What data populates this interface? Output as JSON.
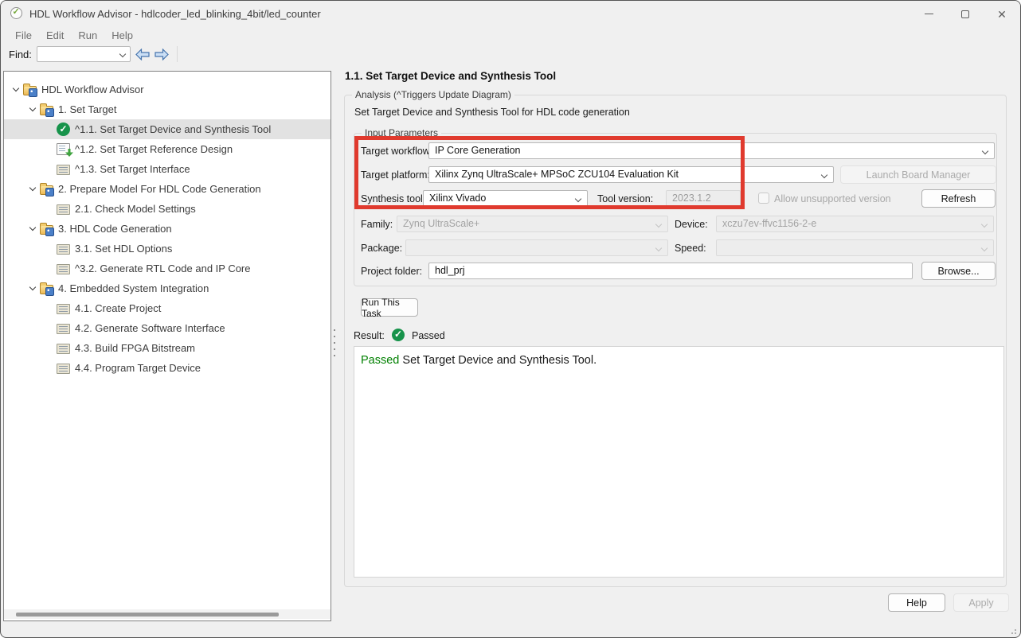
{
  "window": {
    "title": "HDL Workflow Advisor - hdlcoder_led_blinking_4bit/led_counter",
    "icon": "advisor-check-icon"
  },
  "menu": {
    "items": [
      "File",
      "Edit",
      "Run",
      "Help"
    ]
  },
  "toolbar": {
    "find_label": "Find:",
    "find_value": "",
    "icons": {
      "prev": "arrow-left",
      "next": "arrow-right"
    }
  },
  "tree": {
    "items": [
      {
        "label": "HDL Workflow Advisor",
        "depth": 0,
        "icon": "folder",
        "chevron": true,
        "selected": false
      },
      {
        "label": "1. Set Target",
        "depth": 1,
        "icon": "folder",
        "chevron": true,
        "selected": false
      },
      {
        "label": "^1.1. Set Target Device and Synthesis Tool",
        "depth": 2,
        "icon": "passed-check",
        "chevron": false,
        "selected": true
      },
      {
        "label": "^1.2. Set Target Reference Design",
        "depth": 2,
        "icon": "ref-design",
        "chevron": false,
        "selected": false
      },
      {
        "label": "^1.3. Set Target Interface",
        "depth": 2,
        "icon": "task",
        "chevron": false,
        "selected": false
      },
      {
        "label": "2. Prepare Model For HDL Code Generation",
        "depth": 1,
        "icon": "folder",
        "chevron": true,
        "selected": false
      },
      {
        "label": "2.1. Check Model Settings",
        "depth": 2,
        "icon": "task",
        "chevron": false,
        "selected": false
      },
      {
        "label": "3. HDL Code Generation",
        "depth": 1,
        "icon": "folder",
        "chevron": true,
        "selected": false
      },
      {
        "label": "3.1. Set HDL Options",
        "depth": 2,
        "icon": "task",
        "chevron": false,
        "selected": false
      },
      {
        "label": "^3.2. Generate RTL Code and IP Core",
        "depth": 2,
        "icon": "task",
        "chevron": false,
        "selected": false
      },
      {
        "label": "4. Embedded System Integration",
        "depth": 1,
        "icon": "folder",
        "chevron": true,
        "selected": false
      },
      {
        "label": "4.1. Create Project",
        "depth": 2,
        "icon": "task",
        "chevron": false,
        "selected": false
      },
      {
        "label": "4.2. Generate Software Interface",
        "depth": 2,
        "icon": "task",
        "chevron": false,
        "selected": false
      },
      {
        "label": "4.3. Build FPGA Bitstream",
        "depth": 2,
        "icon": "task",
        "chevron": false,
        "selected": false
      },
      {
        "label": "4.4. Program Target Device",
        "depth": 2,
        "icon": "task",
        "chevron": false,
        "selected": false
      }
    ]
  },
  "panel": {
    "title": "1.1. Set Target Device and Synthesis Tool",
    "analysis_group_label": "Analysis (^Triggers Update Diagram)",
    "description": "Set Target Device and Synthesis Tool for HDL code generation",
    "input_group_label": "Input Parameters",
    "fields": {
      "target_workflow": {
        "label": "Target workflow:",
        "value": "IP Core Generation"
      },
      "target_platform": {
        "label": "Target platform:",
        "value": "Xilinx Zynq UltraScale+ MPSoC ZCU104 Evaluation Kit",
        "button": "Launch Board Manager"
      },
      "synthesis_tool": {
        "label": "Synthesis tool:",
        "value": "Xilinx Vivado"
      },
      "tool_version": {
        "label": "Tool version:",
        "value": "2023.1.2"
      },
      "allow_unsupported": {
        "label": "Allow unsupported version",
        "checked": false
      },
      "refresh_button": "Refresh",
      "family": {
        "label": "Family:",
        "value": "Zynq UltraScale+"
      },
      "device": {
        "label": "Device:",
        "value": "xczu7ev-ffvc1156-2-e"
      },
      "package": {
        "label": "Package:",
        "value": ""
      },
      "speed": {
        "label": "Speed:",
        "value": ""
      },
      "project_folder": {
        "label": "Project folder:",
        "value": "hdl_prj",
        "button": "Browse..."
      }
    },
    "run_button": "Run This Task",
    "result": {
      "label": "Result:",
      "status": "Passed"
    },
    "output": {
      "status_word": "Passed",
      "message": " Set Target Device and Synthesis Tool."
    },
    "footer": {
      "help": "Help",
      "apply": "Apply"
    }
  },
  "colors": {
    "annotation_red": "#e03a2e",
    "passed_green": "#17934b",
    "output_passed_text": "#008000",
    "background": "#f0f0f0",
    "selection": "#e2e2e2"
  }
}
